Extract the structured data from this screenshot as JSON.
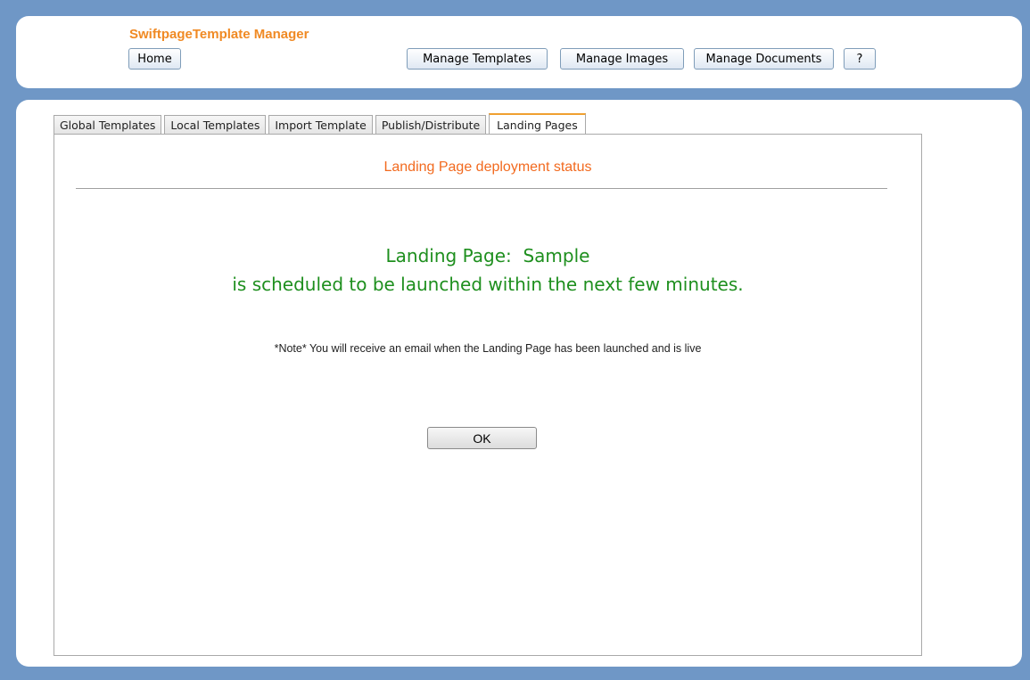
{
  "header": {
    "app_title": "SwiftpageTemplate Manager",
    "home_label": "Home",
    "manage_templates_label": "Manage Templates",
    "manage_images_label": "Manage Images",
    "manage_documents_label": "Manage Documents",
    "help_label": "?"
  },
  "tabs": [
    {
      "label": "Global Templates",
      "active": false
    },
    {
      "label": "Local Templates",
      "active": false
    },
    {
      "label": "Import Template",
      "active": false
    },
    {
      "label": "Publish/Distribute",
      "active": false
    },
    {
      "label": "Landing Pages",
      "active": true
    }
  ],
  "content": {
    "section_title": "Landing Page deployment status",
    "status_line1": "Landing Page:  Sample",
    "status_line2": "is scheduled to be launched within the next few minutes.",
    "note": "*Note* You will receive an email when the Landing Page has been launched and is live",
    "ok_label": "OK"
  },
  "colors": {
    "background": "#6f97c6",
    "title_orange": "#f08a24",
    "status_green": "#1e8f1e",
    "section_title_orange": "#f26a1f"
  }
}
